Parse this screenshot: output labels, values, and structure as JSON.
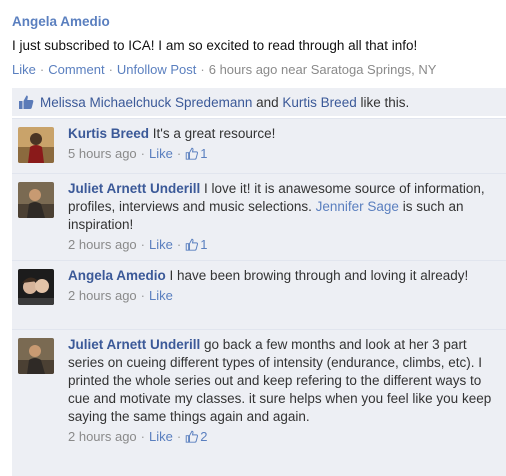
{
  "post": {
    "author": "Angela Amedio",
    "text": "I just subscribed to ICA! I am so excited to read through all that info!",
    "actions": {
      "like": "Like",
      "comment": "Comment",
      "unfollow": "Unfollow Post"
    },
    "time": "6 hours ago",
    "location_prefix": "near",
    "location": "Saratoga Springs, NY"
  },
  "likes": {
    "person1": "Melissa Michaelchuck Spredemann",
    "and": "and",
    "person2": "Kurtis Breed",
    "suffix": "like this."
  },
  "comments": [
    {
      "name": "Kurtis Breed",
      "text": "It's a great resource!",
      "time": "5 hours ago",
      "like": "Like",
      "like_count": "1"
    },
    {
      "name": "Juliet Arnett Underill",
      "text": "I love it! it is anawesome source of information, profiles, interviews and music selections.",
      "mention": "Jennifer Sage",
      "text_after": "is such an inspiration!",
      "time": "2 hours ago",
      "like": "Like",
      "like_count": "1"
    },
    {
      "name": "Angela Amedio",
      "text": "I have been browing through and loving it already!",
      "time": "2 hours ago",
      "like": "Like"
    },
    {
      "name": "Juliet Arnett Underill",
      "text": "go back a few months and look at her 3 part series on cueing different types of intensity (endurance, climbs, etc). I printed the whole series out and keep refering to the different ways to cue and motivate my classes. it sure helps when you feel like you keep saying the same things again and again.",
      "time": "2 hours ago",
      "like": "Like",
      "like_count": "2"
    }
  ]
}
